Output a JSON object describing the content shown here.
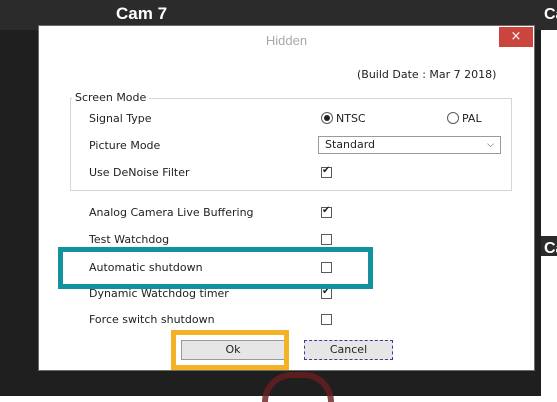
{
  "background": {
    "camera_title": "Cam 7",
    "side_labels": [
      "Ca",
      "Ca"
    ]
  },
  "dialog": {
    "title": "Hidden",
    "close_glyph": "×",
    "build_date": "(Build Date : Mar  7 2018)",
    "screen_mode_label": "Screen Mode",
    "signal_type": {
      "label": "Signal Type",
      "options": [
        "NTSC",
        "PAL"
      ],
      "selected": "NTSC"
    },
    "picture_mode": {
      "label": "Picture Mode",
      "value": "Standard"
    },
    "denoise": {
      "label": "Use DeNoise Filter",
      "checked": true
    },
    "settings": [
      {
        "label": "Analog Camera Live Buffering",
        "checked": true
      },
      {
        "label": "Test Watchdog",
        "checked": false
      },
      {
        "label": "Automatic shutdown",
        "checked": false
      },
      {
        "label": "Dynamic Watchdog timer",
        "checked": true
      },
      {
        "label": "Force switch shutdown",
        "checked": false
      }
    ],
    "buttons": {
      "ok": "Ok",
      "cancel": "Cancel"
    }
  },
  "colors": {
    "highlight_teal": "#12929f",
    "highlight_orange": "#f4b327",
    "close_red": "#c9453e"
  }
}
